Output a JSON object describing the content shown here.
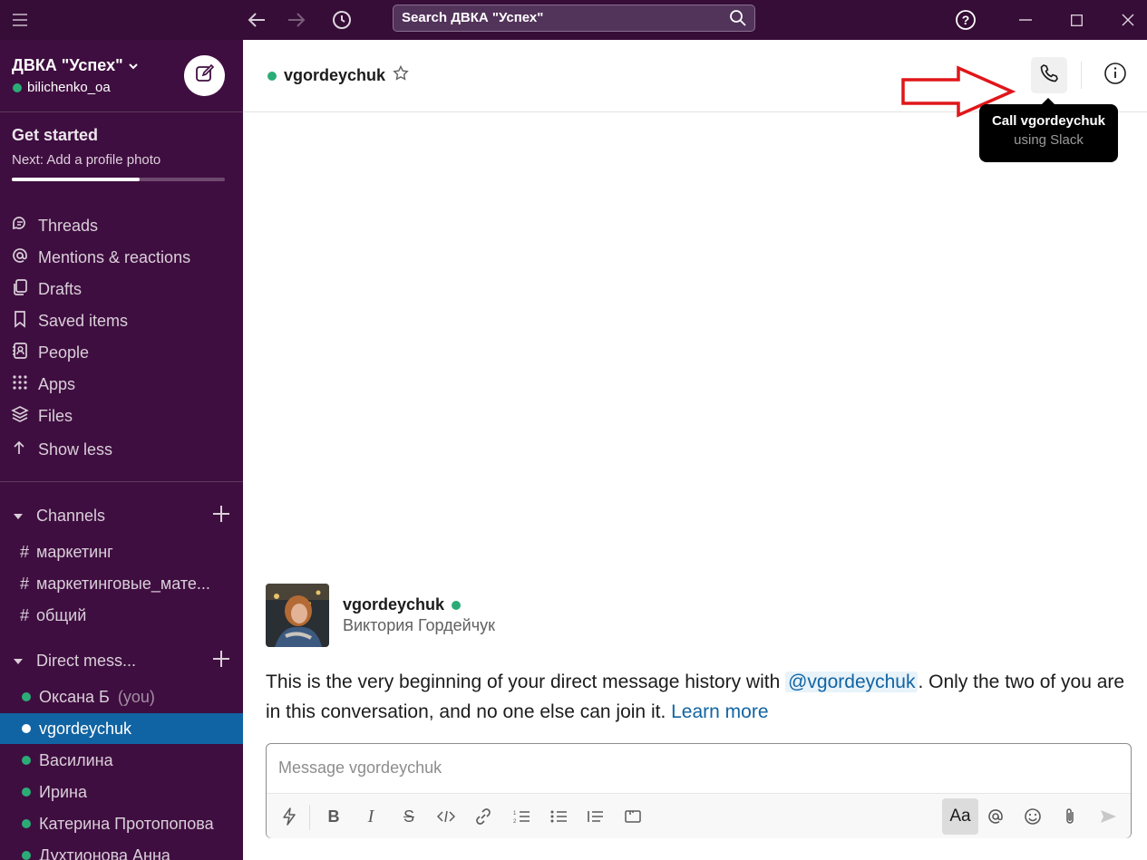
{
  "titlebar": {
    "search_placeholder": "Search ДВКА \"Успех\"",
    "icons": [
      "hamburger-icon",
      "back-arrow-icon",
      "forward-arrow-icon",
      "history-icon",
      "search-icon",
      "help-icon",
      "minimize-icon",
      "maximize-icon",
      "close-icon"
    ]
  },
  "workspace": {
    "name": "ДВКА \"Успех\"",
    "user": "bilichenko_oa"
  },
  "get_started": {
    "title": "Get started",
    "next": "Next: Add a profile photo",
    "progress_fraction": 0.6
  },
  "nav": {
    "items": [
      {
        "label": "Threads",
        "icon": "threads-icon"
      },
      {
        "label": "Mentions & reactions",
        "icon": "at-icon"
      },
      {
        "label": "Drafts",
        "icon": "drafts-icon"
      },
      {
        "label": "Saved items",
        "icon": "bookmark-icon"
      },
      {
        "label": "People",
        "icon": "people-icon"
      },
      {
        "label": "Apps",
        "icon": "apps-grid-icon"
      },
      {
        "label": "Files",
        "icon": "files-stack-icon"
      },
      {
        "label": "Show less",
        "icon": "arrow-up-icon"
      }
    ]
  },
  "channels": {
    "header": "Channels",
    "items": [
      "маркетинг",
      "маркетинговые_мате...",
      "общий"
    ]
  },
  "direct_messages": {
    "header": "Direct mess...",
    "items": [
      {
        "name": "Оксана Б",
        "suffix": "(you)"
      },
      {
        "name": "vgordeychuk",
        "suffix": ""
      },
      {
        "name": "Василина",
        "suffix": ""
      },
      {
        "name": "Ирина",
        "suffix": ""
      },
      {
        "name": "Катерина Протопопова",
        "suffix": ""
      },
      {
        "name": "Духтионова Анна",
        "suffix": ""
      }
    ],
    "active_index": 1
  },
  "conversation": {
    "title": "vgordeychuk",
    "tooltip_title": "Call vgordeychuk",
    "tooltip_sub": "using Slack"
  },
  "intro": {
    "username": "vgordeychuk",
    "real_name": "Виктория Гордейчук",
    "text_before": "This is the very beginning of your direct message history with ",
    "mention": "@vgordeychuk",
    "text_after": ". Only the two of you are in this conversation, and no one else can join it. ",
    "learn_more": "Learn more"
  },
  "composer": {
    "placeholder": "Message vgordeychuk",
    "format_button": "Aa"
  },
  "colors": {
    "sidebar_bg": "#3f0e40",
    "titlebar_bg": "#350d36",
    "active_item": "#1164a3",
    "presence_green": "#2bac76",
    "link_blue": "#1264a3",
    "annotation_red": "#e0161a"
  }
}
